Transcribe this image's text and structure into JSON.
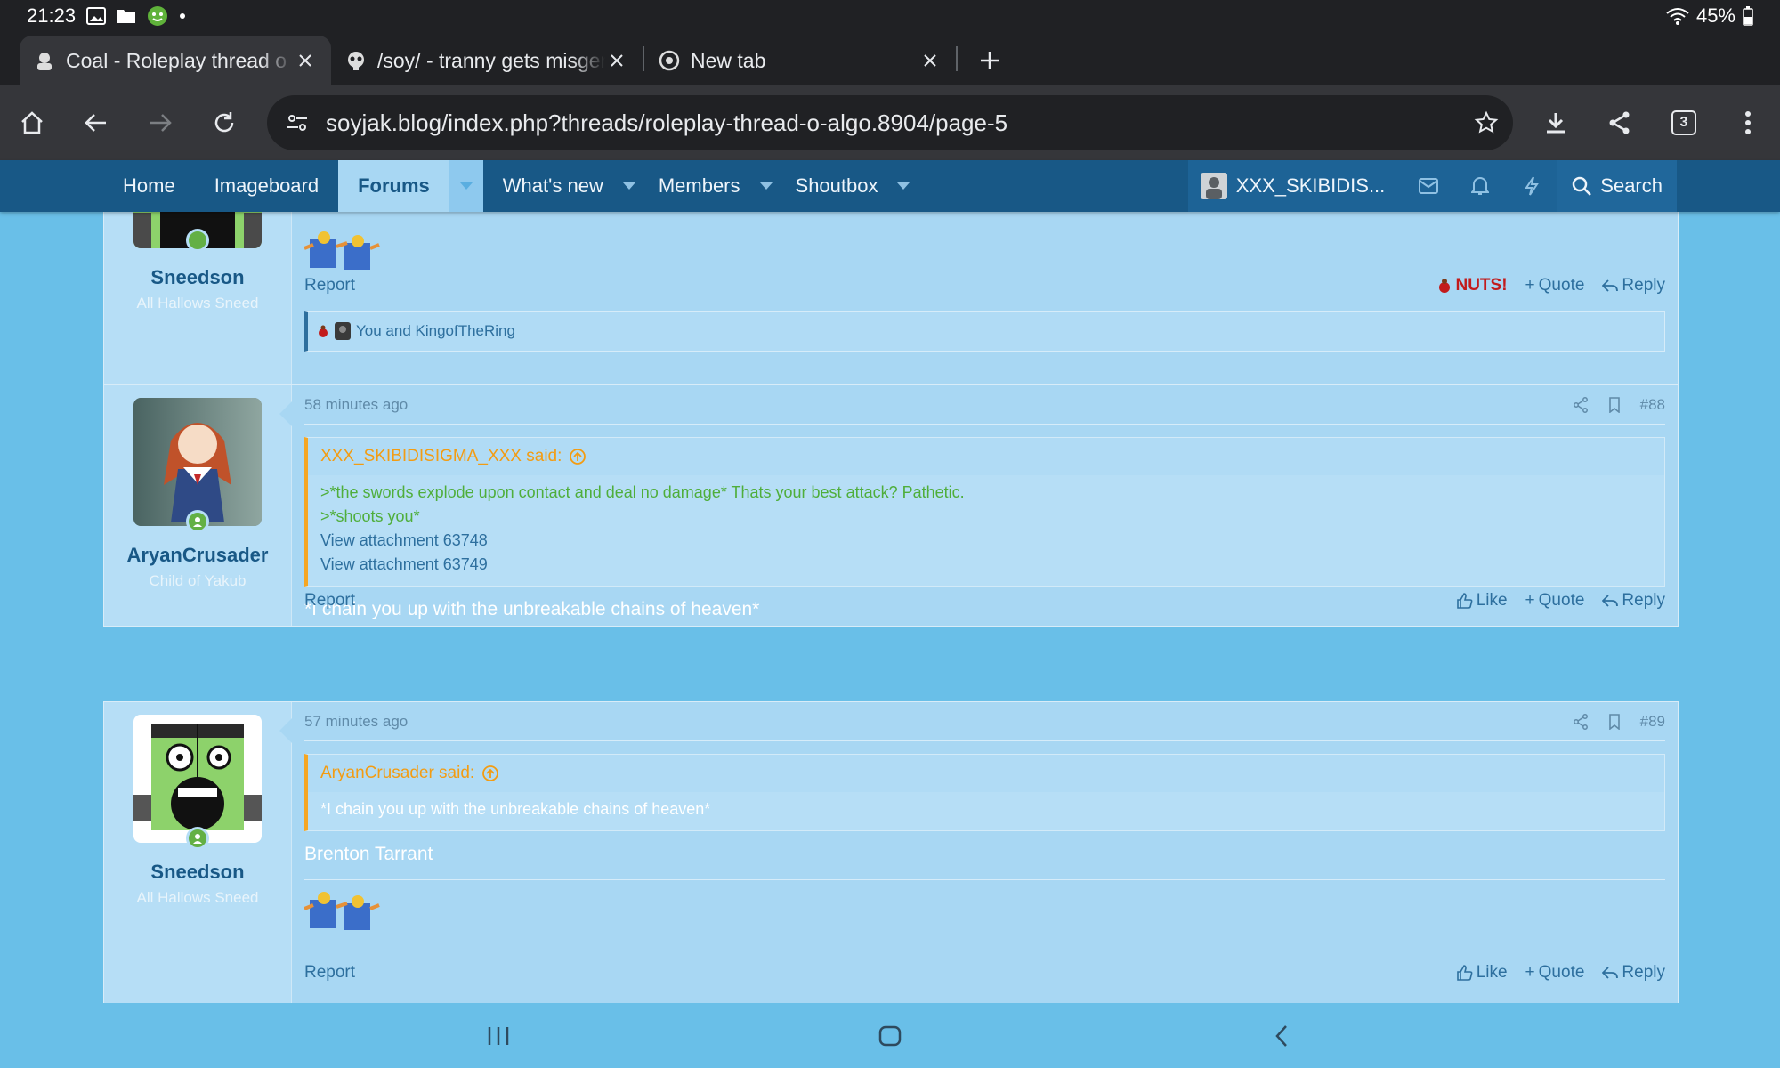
{
  "status_bar": {
    "time": "21:23",
    "battery": "45%"
  },
  "tabs": [
    {
      "title": "Coal - Roleplay thread o algo",
      "active": true
    },
    {
      "title": "/soy/ - tranny gets misgendered",
      "active": false
    },
    {
      "title": "New tab",
      "active": false
    }
  ],
  "toolbar": {
    "url": "soyjak.blog/index.php?threads/roleplay-thread-o-algo.8904/page-5",
    "tab_count": "3"
  },
  "site_nav": {
    "items": [
      "Home",
      "Imageboard",
      "Forums",
      "What's new",
      "Members",
      "Shoutbox"
    ],
    "user": "XXX_SKIBIDIS...",
    "search": "Search"
  },
  "posts": [
    {
      "username": "Sneedson",
      "user_title": "All Hallows Sneed",
      "report": "Report",
      "reaction": "NUTS!",
      "quote": "Quote",
      "reply": "Reply",
      "reactions_summary": "You and KingofTheRing"
    },
    {
      "username": "AryanCrusader",
      "user_title": "Child of Yakub",
      "time": "58 minutes ago",
      "number": "#88",
      "quote_author": "XXX_SKIBIDISIGMA_XXX said:",
      "quote_lines": [
        ">*the swords explode upon contact and deal no damage* Thats your best attack? Pathetic.",
        ">*shoots you*"
      ],
      "attachments": [
        "View attachment 63748",
        "View attachment 63749"
      ],
      "text": "*I chain you up with the unbreakable chains of heaven*",
      "report": "Report",
      "like": "Like",
      "quote": "Quote",
      "reply": "Reply"
    },
    {
      "username": "Sneedson",
      "user_title": "All Hallows Sneed",
      "time": "57 minutes ago",
      "number": "#89",
      "quote_author": "AryanCrusader said:",
      "quote_text": "*I chain you up with the unbreakable chains of heaven*",
      "text": "Brenton Tarrant",
      "report": "Report",
      "like": "Like",
      "quote": "Quote",
      "reply": "Reply"
    }
  ],
  "colors": {
    "nav_bg": "#185886",
    "page_bg": "#69bfe8",
    "post_bg": "#a8d7f3",
    "greentext": "#4fae3b",
    "quote_accent": "#f5a623"
  }
}
